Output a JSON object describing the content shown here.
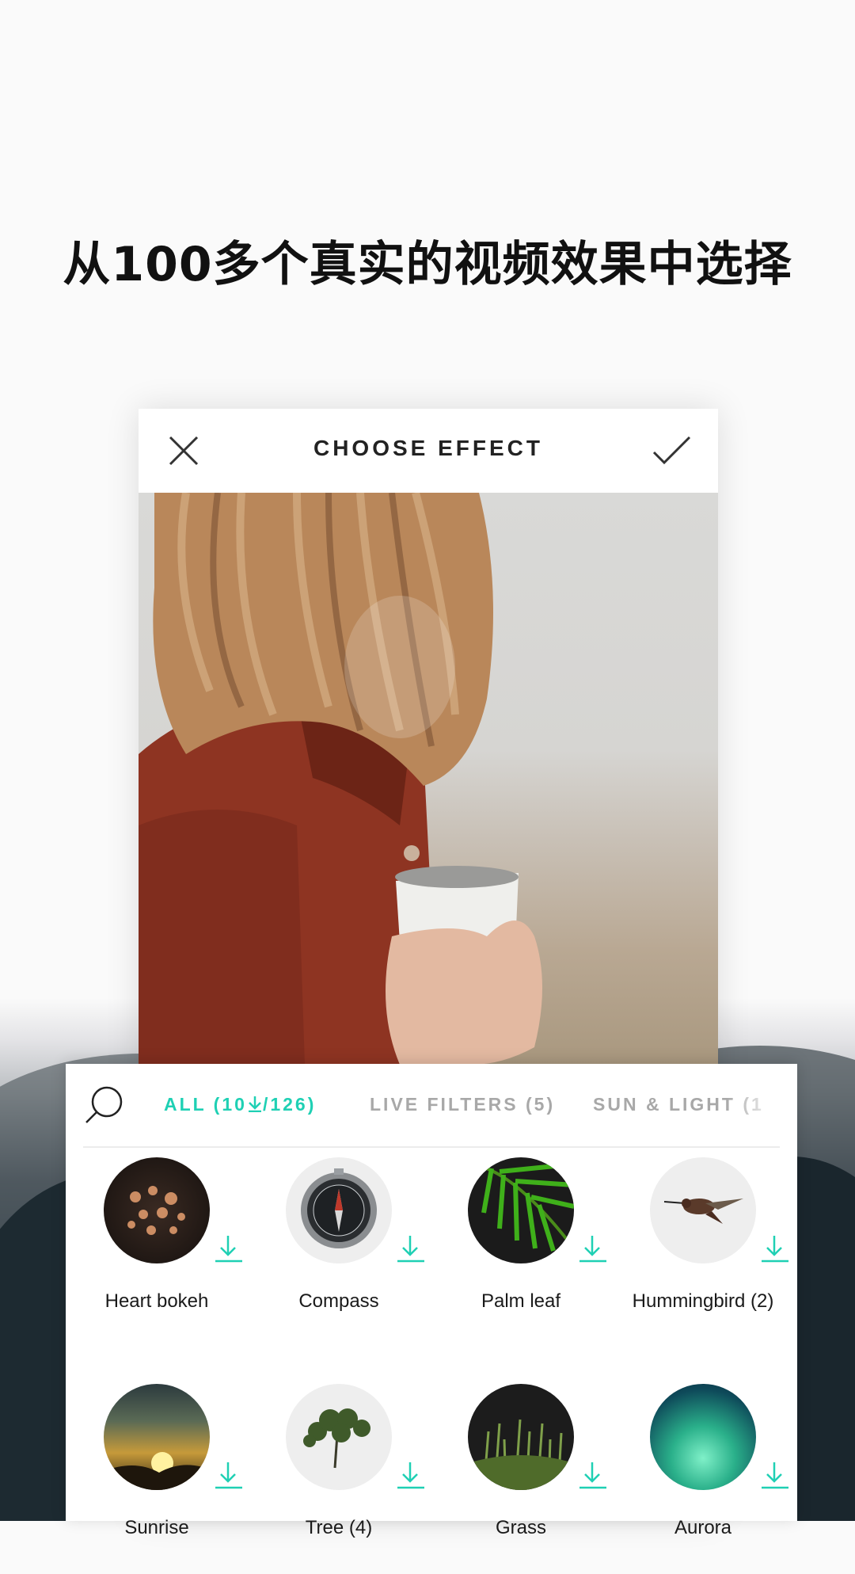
{
  "headline": "从100多个真实的视频效果中选择",
  "header": {
    "title": "CHOOSE EFFECT",
    "close_icon": "close-icon",
    "confirm_icon": "checkmark-icon"
  },
  "tabs": [
    {
      "label": "ALL (10",
      "label_suffix": "/126)",
      "icon": "download-arrow-icon",
      "active": true
    },
    {
      "label": "LIVE FILTERS (5)",
      "active": false
    },
    {
      "label": "SUN & LIGHT (1",
      "active": false
    }
  ],
  "search_icon": "search-icon",
  "accent_color": "#1fd0b4",
  "effects": [
    {
      "label": "Heart bokeh",
      "icon": "heart-bokeh-thumbnail"
    },
    {
      "label": "Compass",
      "icon": "compass-thumbnail"
    },
    {
      "label": "Palm leaf",
      "icon": "palm-leaf-thumbnail"
    },
    {
      "label": "Hummingbird (2)",
      "icon": "hummingbird-thumbnail"
    },
    {
      "label": "Sunrise",
      "icon": "sunrise-thumbnail"
    },
    {
      "label": "Tree (4)",
      "icon": "tree-thumbnail"
    },
    {
      "label": "Grass",
      "icon": "grass-thumbnail"
    },
    {
      "label": "Aurora",
      "icon": "aurora-thumbnail"
    }
  ]
}
